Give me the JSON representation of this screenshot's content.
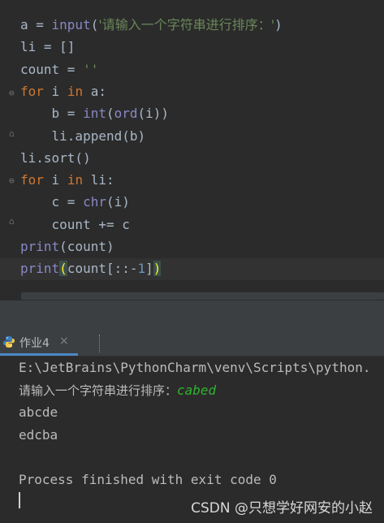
{
  "editor": {
    "lines": [
      {
        "parts": [
          [
            "plain",
            "a = "
          ],
          [
            "bi",
            "input"
          ],
          [
            "plain",
            "("
          ],
          [
            "str",
            "'请输入一个字符串进行排序：'"
          ],
          [
            "plain",
            ")"
          ]
        ]
      },
      {
        "parts": [
          [
            "plain",
            "li = []"
          ]
        ]
      },
      {
        "parts": [
          [
            "plain",
            "count = "
          ],
          [
            "str",
            "''"
          ]
        ]
      },
      {
        "parts": [
          [
            "kw",
            "for"
          ],
          [
            "plain",
            " i "
          ],
          [
            "kw",
            "in"
          ],
          [
            "plain",
            " a:"
          ]
        ]
      },
      {
        "parts": [
          [
            "plain",
            "    b = "
          ],
          [
            "bi",
            "int"
          ],
          [
            "plain",
            "("
          ],
          [
            "bi",
            "ord"
          ],
          [
            "plain",
            "(i))"
          ]
        ]
      },
      {
        "parts": [
          [
            "plain",
            "    li.append(b)"
          ]
        ]
      },
      {
        "parts": [
          [
            "plain",
            "li.sort()"
          ]
        ]
      },
      {
        "parts": [
          [
            "kw",
            "for"
          ],
          [
            "plain",
            " i "
          ],
          [
            "kw",
            "in"
          ],
          [
            "plain",
            " li:"
          ]
        ]
      },
      {
        "parts": [
          [
            "plain",
            "    c = "
          ],
          [
            "bi",
            "chr"
          ],
          [
            "plain",
            "(i)"
          ]
        ]
      },
      {
        "parts": [
          [
            "plain",
            "    count += c"
          ]
        ]
      },
      {
        "parts": [
          [
            "bi",
            "print"
          ],
          [
            "plain",
            "(count)"
          ]
        ]
      },
      {
        "parts": [
          [
            "bi",
            "print"
          ],
          [
            "hl",
            "("
          ],
          [
            "plain",
            "count[::-"
          ],
          [
            "num",
            "1"
          ],
          [
            "plain",
            "]"
          ],
          [
            "hl",
            ")"
          ]
        ]
      }
    ]
  },
  "run_panel": {
    "tab_label": "作业4",
    "tab_close": "×"
  },
  "console": {
    "command": "E:\\JetBrains\\PythonCharm\\venv\\Scripts\\python.",
    "prompt": "请输入一个字符串进行排序：",
    "user_input": "cabed",
    "output_1": "abcde",
    "output_2": "edcba",
    "finish": "Process finished with exit code 0"
  },
  "watermark": "CSDN @只想学好网安的小赵",
  "colors": {
    "keyword": "#cc7832",
    "builtin": "#8888c6",
    "string": "#6a8759",
    "number": "#6897bb",
    "user_input": "#2fb32f",
    "tab_accent": "#4a88c7"
  }
}
